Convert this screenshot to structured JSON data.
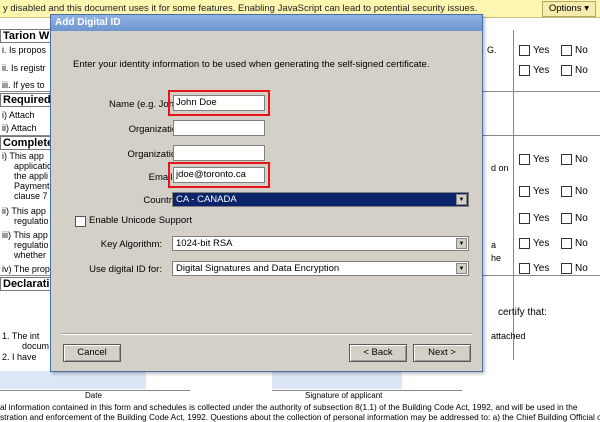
{
  "warning_bar": {
    "message": "y disabled and this document uses it for some features. Enabling JavaScript can lead to potential security issues.",
    "options_label": "Options",
    "options_arrow": "▾"
  },
  "document": {
    "sections": {
      "tarion": "Tarion W",
      "required": "Required",
      "complete": "Complete",
      "declaration": "Declarati"
    },
    "tarion_items": [
      "i.   Is propos",
      "ii.  Is registr",
      "iii. If yes to"
    ],
    "required_items": [
      "i)   Attach",
      "ii)  Attach"
    ],
    "complete_items": [
      "i)   This app",
      "applicatio",
      "the appli",
      "Payment",
      "clause 7",
      "ii)  This app",
      "regulatio",
      "iii)  This app",
      "regulatio",
      "whether",
      "iv)  The prop"
    ],
    "right_fragments": {
      "g": "G.",
      "d_on": "d on",
      "a": "a",
      "the": "he"
    },
    "yes_label": "Yes",
    "no_label": "No",
    "declaration_text": {
      "certify": "certify that:",
      "item1": "1.    The int",
      "item1b": "docum",
      "item2": "2.    I have",
      "attached": "attached",
      "chief": "e Chief Building Official of the"
    },
    "sig_labels": {
      "date": "Date",
      "signature": "Signature of applicant"
    },
    "footer": [
      "al information contained in this form and schedules is collected under the authority of subsection 8(1.1) of the Building Code Act, 1992, and will be used in the",
      "stration and enforcement of the Building Code Act, 1992. Questions about the collection of personal information may be addressed to: a) the Chief Building Official of the"
    ]
  },
  "dialog": {
    "title": "Add Digital ID",
    "instruction": "Enter your identity information to be used when generating the self-signed certificate.",
    "fields": {
      "name": {
        "label": "Name (e.g. John Smith):",
        "value": "John Doe"
      },
      "org_unit": {
        "label": "Organizational Unit:",
        "value": ""
      },
      "org_name": {
        "label": "Organization Name:",
        "value": ""
      },
      "email": {
        "label": "Email Address:",
        "value": "jdoe@toronto.ca"
      }
    },
    "country": {
      "label": "Country/Region:",
      "value": "CA - CANADA"
    },
    "unicode_checkbox": {
      "label": "Enable Unicode Support",
      "checked": false
    },
    "key_algorithm": {
      "label": "Key Algorithm:",
      "value": "1024-bit RSA"
    },
    "use_for": {
      "label": "Use digital ID for:",
      "value": "Digital Signatures and Data Encryption"
    },
    "buttons": {
      "cancel": "Cancel",
      "back": "< Back",
      "next": "Next >"
    },
    "highlight_color": "#e8141b"
  }
}
